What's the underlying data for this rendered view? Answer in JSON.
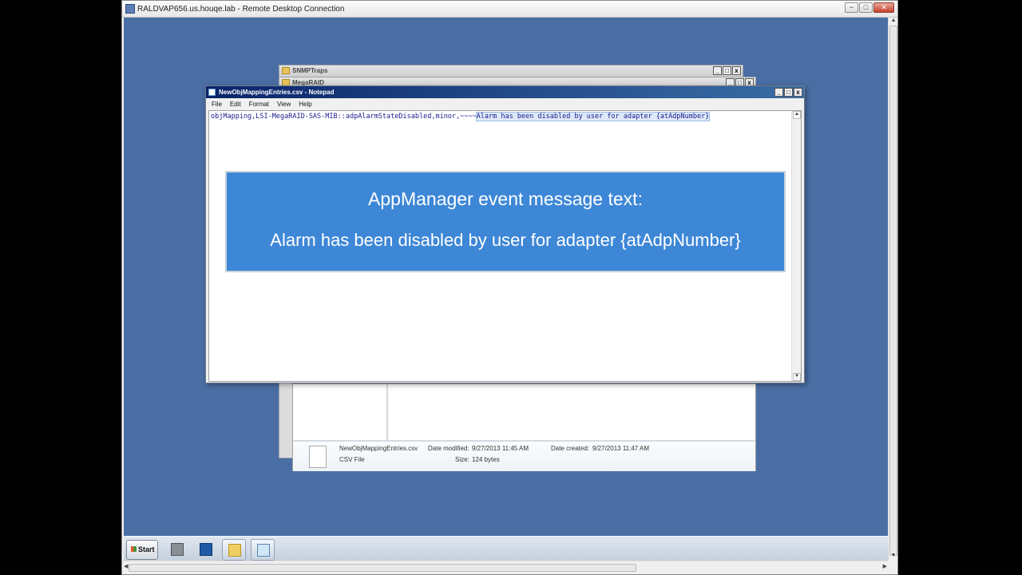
{
  "rdp": {
    "title": "RALDVAP656.us.houqe.lab - Remote Desktop Connection",
    "min": "−",
    "max": "□",
    "close": "✕"
  },
  "background_windows": [
    {
      "title": "SNMPTraps"
    },
    {
      "title": "MegaRAID"
    }
  ],
  "notepad": {
    "title": "NewObjMappingEntries.csv - Notepad",
    "menu": [
      "File",
      "Edit",
      "Format",
      "View",
      "Help"
    ],
    "line_prefix": "objMapping,LSI-MegaRAID-SAS-MIB::adpAlarmStateDisabled,minor,~~~~",
    "line_selected": "Alarm has been disabled by user for adapter {atAdpNumber}"
  },
  "callout": {
    "line1": "AppManager event message text:",
    "line2": "Alarm has been disabled by user for adapter {atAdpNumber}",
    "bg_color": "#3d87d6"
  },
  "details_pane": {
    "file_name": "NewObjMappingEntries.csv",
    "file_type": "CSV File",
    "date_modified_label": "Date modified:",
    "date_modified": "9/27/2013 11:45 AM",
    "date_created_label": "Date created:",
    "date_created": "9/27/2013 11:47 AM",
    "size_label": "Size:",
    "size": "124 bytes"
  },
  "taskbar": {
    "start_label": "Start",
    "items": [
      "server-manager-icon",
      "powershell-icon",
      "explorer-icon",
      "notepad-icon"
    ]
  },
  "desktop_color": "#4a6ea3"
}
